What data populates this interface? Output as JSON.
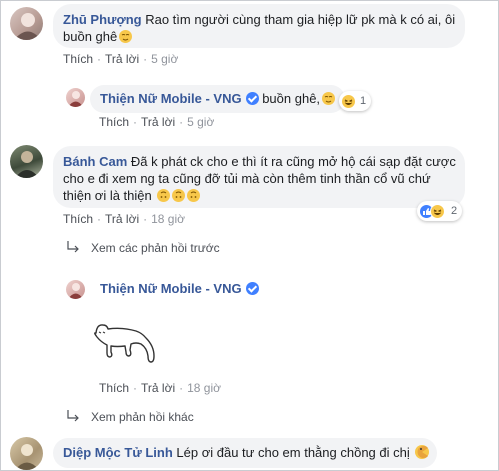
{
  "actions": {
    "like": "Thích",
    "reply": "Trả lời"
  },
  "comments": [
    {
      "author": "Zhū Phượng",
      "text_line1": "Rao tìm người cùng tham gia hiệp lữ pk mà k có ai, ôi",
      "text_line2": "buồn ghê",
      "time": "5 giờ",
      "replies": [
        {
          "author": "Thiện Nữ Mobile - VNG",
          "text": "buồn ghê,",
          "reaction_count": "1",
          "time": "5 giờ"
        }
      ]
    },
    {
      "author": "Bánh Cam",
      "text_line1": "Đã k phát ck cho e thì ít ra cũng mở hộ cái sạp đặt cược",
      "text_line2": "cho e đi xem ng ta cũng đỡ tủi mà còn thêm tinh thần cổ vũ chứ",
      "text_line3": "thiện ơi là thiện",
      "time": "18 giờ",
      "reaction_count": "2",
      "previous_replies_link": "Xem các phản hồi trước",
      "replies": [
        {
          "author": "Thiện Nữ Mobile - VNG",
          "time": "18 giờ"
        }
      ],
      "more_replies_link": "Xem phản hồi khác"
    },
    {
      "author": "Diệp Mộc Tử Linh",
      "text": "Lép ơi đầu tư cho em thằng chồng đi chị"
    }
  ],
  "colors": {
    "name": "#385898",
    "bubble": "#f2f3f5",
    "verified": "#4080ff",
    "meta": "#90949c"
  }
}
